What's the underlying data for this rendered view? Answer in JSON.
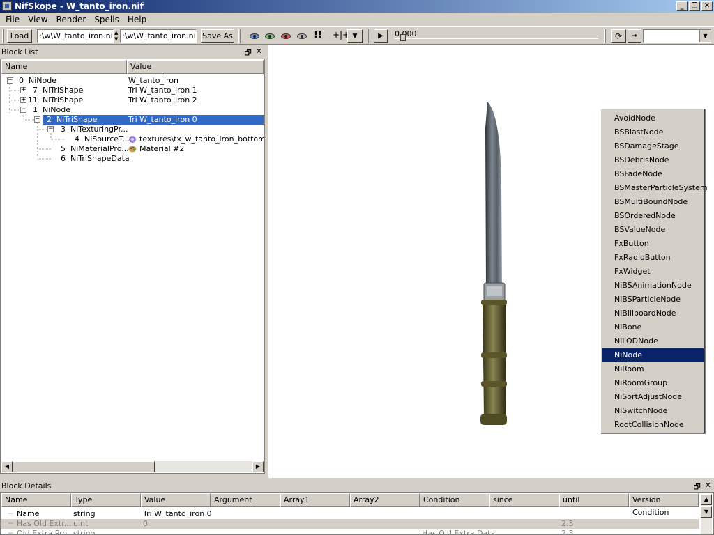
{
  "window": {
    "title": "NifSkope - W_tanto_iron.nif"
  },
  "menu": [
    "File",
    "View",
    "Render",
    "Spells",
    "Help"
  ],
  "toolbar": {
    "load_label": "Load",
    "load_path": ":\\w\\W_tanto_iron.nif",
    "save_path": ":\\w\\W_tanto_iron.nif",
    "save_as_label": "Save As",
    "time_value": "0.000"
  },
  "block_list": {
    "title": "Block List",
    "columns": [
      "Name",
      "Value"
    ],
    "rows": [
      {
        "index": "0",
        "name": "NiNode",
        "value": "W_tanto_iron",
        "expander": "−"
      },
      {
        "index": "7",
        "name": "NiTriShape",
        "value": "Tri W_tanto_iron 1",
        "expander": "+"
      },
      {
        "index": "11",
        "name": "NiTriShape",
        "value": "Tri W_tanto_iron 2",
        "expander": "+"
      },
      {
        "index": "1",
        "name": "NiNode",
        "value": "",
        "expander": "−"
      },
      {
        "index": "2",
        "name": "NiTriShape",
        "value": "Tri W_tanto_iron 0",
        "expander": "−"
      },
      {
        "index": "3",
        "name": "NiTexturingPr...",
        "value": "",
        "expander": "−"
      },
      {
        "index": "4",
        "name": "NiSourceT...",
        "value": "textures\\tx_w_tanto_iron_bottom.dds",
        "expander": ""
      },
      {
        "index": "5",
        "name": "NiMaterialPro...",
        "value": "Material #2",
        "expander": ""
      },
      {
        "index": "6",
        "name": "NiTriShapeData",
        "value": "",
        "expander": ""
      }
    ]
  },
  "context_menu": {
    "items": [
      "AvoidNode",
      "BSBlastNode",
      "BSDamageStage",
      "BSDebrisNode",
      "BSFadeNode",
      "BSMasterParticleSystem",
      "BSMultiBoundNode",
      "BSOrderedNode",
      "BSValueNode",
      "FxButton",
      "FxRadioButton",
      "FxWidget",
      "NiBSAnimationNode",
      "NiBSParticleNode",
      "NiBillboardNode",
      "NiBone",
      "NiLODNode",
      "NiNode",
      "NiRoom",
      "NiRoomGroup",
      "NiSortAdjustNode",
      "NiSwitchNode",
      "RootCollisionNode"
    ],
    "highlighted": "NiNode"
  },
  "block_details": {
    "title": "Block Details",
    "columns": [
      "Name",
      "Type",
      "Value",
      "Argument",
      "Array1",
      "Array2",
      "Condition",
      "since",
      "until",
      "Version Condition"
    ],
    "rows": [
      {
        "name": "Name",
        "type": "string",
        "value": "Tri W_tanto_iron 0",
        "condition": "",
        "until": ""
      },
      {
        "name": "Has Old Extr...",
        "type": "uint",
        "value": "0",
        "condition": "",
        "until": "2.3"
      },
      {
        "name": "Old Extra Pro...",
        "type": "string",
        "value": "",
        "condition": "Has Old Extra Data",
        "until": "2.3"
      }
    ]
  },
  "colors": {
    "selection": "#316ac5",
    "menu_highlight": "#0a246a",
    "chrome": "#d4d0c8"
  }
}
